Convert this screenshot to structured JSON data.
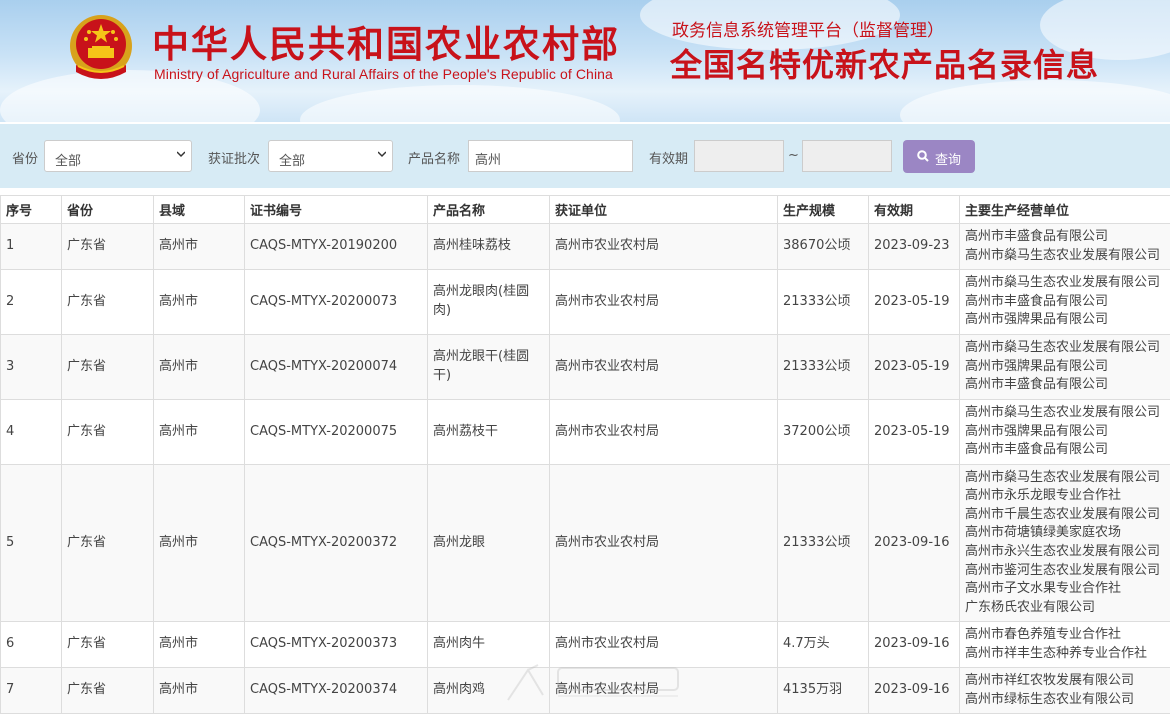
{
  "header": {
    "cn_title": "中华人民共和国农业农村部",
    "en_title": "Ministry of Agriculture and Rural Affairs of the People's Republic of China",
    "platform_subtitle": "政务信息系统管理平台（监督管理）",
    "platform_title": "全国名特优新农产品名录信息",
    "brand_color": "#c8121a"
  },
  "filters": {
    "province_label": "省份",
    "province_value": "全部",
    "batch_label": "获证批次",
    "batch_value": "全部",
    "product_label": "产品名称",
    "product_value": "高州",
    "validity_label": "有效期",
    "range_sep": "~",
    "query_label": "查询",
    "query_icon": "search-icon"
  },
  "table": {
    "headers": [
      "序号",
      "省份",
      "县域",
      "证书编号",
      "产品名称",
      "获证单位",
      "生产规模",
      "有效期",
      "主要生产经营单位"
    ],
    "rows": [
      {
        "no": "1",
        "province": "广东省",
        "county": "高州市",
        "cert": "CAQS-MTYX-20190200",
        "product": "高州桂味荔枝",
        "unit": "高州市农业农村局",
        "scale": "38670公顷",
        "valid": "2023-09-23",
        "producers": [
          "高州市丰盛食品有限公司",
          "高州市燊马生态农业发展有限公司"
        ]
      },
      {
        "no": "2",
        "province": "广东省",
        "county": "高州市",
        "cert": "CAQS-MTYX-20200073",
        "product": "高州龙眼肉(桂圆肉)",
        "unit": "高州市农业农村局",
        "scale": "21333公顷",
        "valid": "2023-05-19",
        "producers": [
          "高州市燊马生态农业发展有限公司",
          "高州市丰盛食品有限公司",
          "高州市强牌果品有限公司"
        ]
      },
      {
        "no": "3",
        "province": "广东省",
        "county": "高州市",
        "cert": "CAQS-MTYX-20200074",
        "product": "高州龙眼干(桂圆干)",
        "unit": "高州市农业农村局",
        "scale": "21333公顷",
        "valid": "2023-05-19",
        "producers": [
          "高州市燊马生态农业发展有限公司",
          "高州市强牌果品有限公司",
          "高州市丰盛食品有限公司"
        ]
      },
      {
        "no": "4",
        "province": "广东省",
        "county": "高州市",
        "cert": "CAQS-MTYX-20200075",
        "product": "高州荔枝干",
        "unit": "高州市农业农村局",
        "scale": "37200公顷",
        "valid": "2023-05-19",
        "producers": [
          "高州市燊马生态农业发展有限公司",
          "高州市强牌果品有限公司",
          "高州市丰盛食品有限公司"
        ]
      },
      {
        "no": "5",
        "province": "广东省",
        "county": "高州市",
        "cert": "CAQS-MTYX-20200372",
        "product": "高州龙眼",
        "unit": "高州市农业农村局",
        "scale": "21333公顷",
        "valid": "2023-09-16",
        "producers": [
          "高州市燊马生态农业发展有限公司",
          "高州市永乐龙眼专业合作社",
          "高州市千晨生态农业发展有限公司",
          "高州市荷塘镇绿美家庭农场",
          "高州市永兴生态农业发展有限公司",
          "高州市鉴河生态农业发展有限公司",
          "高州市子文水果专业合作社",
          "广东杨氏农业有限公司"
        ]
      },
      {
        "no": "6",
        "province": "广东省",
        "county": "高州市",
        "cert": "CAQS-MTYX-20200373",
        "product": "高州肉牛",
        "unit": "高州市农业农村局",
        "scale": "4.7万头",
        "valid": "2023-09-16",
        "producers": [
          "高州市春色养殖专业合作社",
          "高州市祥丰生态种养专业合作社"
        ]
      },
      {
        "no": "7",
        "province": "广东省",
        "county": "高州市",
        "cert": "CAQS-MTYX-20200374",
        "product": "高州肉鸡",
        "unit": "高州市农业农村局",
        "scale": "4135万羽",
        "valid": "2023-09-16",
        "producers": [
          "高州市祥红农牧发展有限公司",
          "高州市绿标生态农业有限公司"
        ]
      }
    ]
  }
}
